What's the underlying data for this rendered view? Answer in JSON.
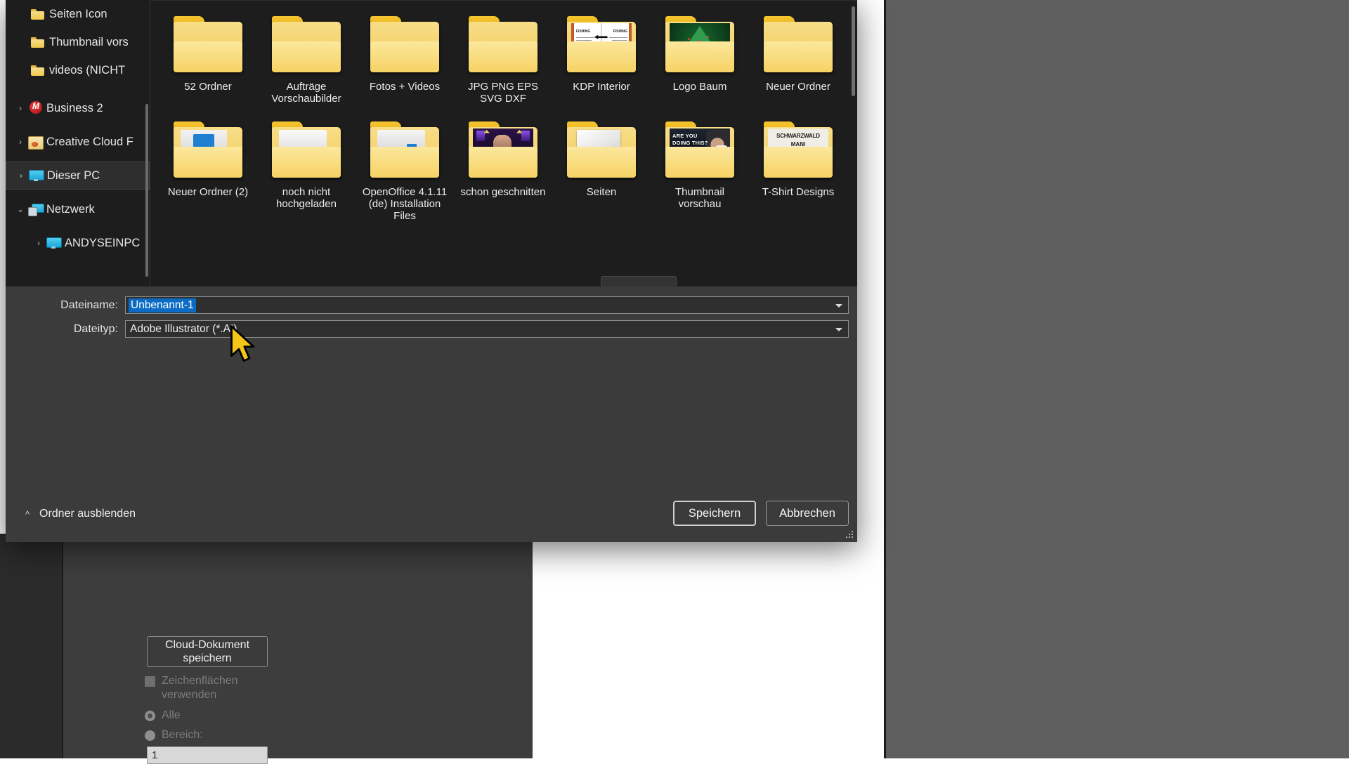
{
  "dialog": {
    "filename_label": "Dateiname:",
    "filename_value": "Unbenannt-1",
    "filetype_label": "Dateityp:",
    "filetype_value": "Adobe Illustrator (*.AI)",
    "cloud_button_line1": "Cloud-Dokument",
    "cloud_button_line2": "speichern",
    "checkbox_line1": "Zeichenflächen",
    "checkbox_line2": "verwenden",
    "radio_all": "Alle",
    "radio_range": "Bereich:",
    "range_value": "1",
    "hide_folders": "Ordner ausblenden",
    "save_button": "Speichern",
    "cancel_button": "Abbrechen",
    "accent_selection": "#0a6cc4"
  },
  "nav_tree": {
    "items": [
      {
        "label": "Seiten Icon",
        "icon": "folder-icon",
        "indent": 2,
        "chevron": "",
        "selected": false
      },
      {
        "label": "Thumbnail vors",
        "icon": "folder-icon",
        "indent": 2,
        "chevron": "",
        "selected": false
      },
      {
        "label": "videos (NICHT",
        "icon": "folder-icon",
        "indent": 2,
        "chevron": "",
        "selected": false
      },
      {
        "label": "Business 2",
        "icon": "mega-drive-icon",
        "indent": 1,
        "chevron": "›",
        "selected": false
      },
      {
        "label": "Creative Cloud F",
        "icon": "creative-cloud-icon",
        "indent": 1,
        "chevron": "›",
        "selected": false
      },
      {
        "label": "Dieser PC",
        "icon": "this-pc-icon",
        "indent": 1,
        "chevron": "›",
        "selected": true
      },
      {
        "label": "Netzwerk",
        "icon": "network-icon",
        "indent": 1,
        "chevron": "⌄",
        "selected": false
      },
      {
        "label": "ANDYSEINPC",
        "icon": "this-pc-icon",
        "indent": 2,
        "chevron": "›",
        "selected": false
      }
    ]
  },
  "folder_grid": {
    "items": [
      {
        "name": "52 Ordner",
        "thumb": "none"
      },
      {
        "name": "Aufträge Vorschaubilder",
        "thumb": "none"
      },
      {
        "name": "Fotos + Videos",
        "thumb": "none"
      },
      {
        "name": "JPG PNG EPS SVG DXF",
        "thumb": "none"
      },
      {
        "name": "KDP Interior",
        "thumb": "kdp-book"
      },
      {
        "name": "Logo Baum",
        "thumb": "green-tree"
      },
      {
        "name": "Neuer Ordner",
        "thumb": "none"
      },
      {
        "name": "Neuer Ordner (2)",
        "thumb": "blue-doc"
      },
      {
        "name": "noch nicht hochgeladen",
        "thumb": "white-doc"
      },
      {
        "name": "OpenOffice 4.1.11 (de) Installation Files",
        "thumb": "white-doc-icon"
      },
      {
        "name": "schon geschnitten",
        "thumb": "video-person"
      },
      {
        "name": "Seiten",
        "thumb": "paper-stack"
      },
      {
        "name": "Thumbnail vorschau",
        "thumb": "are-you-doing-this"
      },
      {
        "name": "T-Shirt Designs",
        "thumb": "schwarzwald"
      }
    ],
    "thumb_texts": {
      "kdp_left": "FISHING",
      "kdp_right": "FISHING",
      "thumbnail_l1": "ARE YOU",
      "thumbnail_l2": "DOING THIS?",
      "tshirt_l1": "SCHWARZWALD",
      "tshirt_l2": "MANI"
    }
  }
}
